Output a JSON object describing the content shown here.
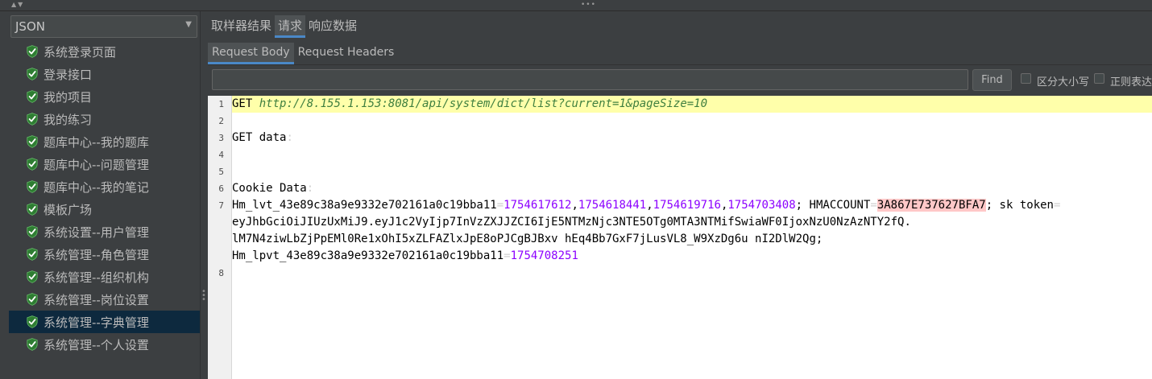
{
  "left_panel": {
    "combo": {
      "value": "JSON"
    },
    "tree": [
      {
        "label": "系统登录页面",
        "selected": false
      },
      {
        "label": "登录接口",
        "selected": false
      },
      {
        "label": "我的项目",
        "selected": false
      },
      {
        "label": "我的练习",
        "selected": false
      },
      {
        "label": "题库中心--我的题库",
        "selected": false
      },
      {
        "label": "题库中心--问题管理",
        "selected": false
      },
      {
        "label": "题库中心--我的笔记",
        "selected": false
      },
      {
        "label": "模板广场",
        "selected": false
      },
      {
        "label": "系统设置--用户管理",
        "selected": false
      },
      {
        "label": "系统管理--角色管理",
        "selected": false
      },
      {
        "label": "系统管理--组织机构",
        "selected": false
      },
      {
        "label": "系统管理--岗位设置",
        "selected": false
      },
      {
        "label": "系统管理--字典管理",
        "selected": true
      },
      {
        "label": "系统管理--个人设置",
        "selected": false
      }
    ],
    "status_icon": "green-shield-check-icon"
  },
  "result_tabs": [
    {
      "label": "取样器结果",
      "active": false
    },
    {
      "label": "请求",
      "active": true
    },
    {
      "label": "响应数据",
      "active": false
    }
  ],
  "request_tabs": [
    {
      "label": "Request Body",
      "active": true
    },
    {
      "label": "Request Headers",
      "active": false
    }
  ],
  "search": {
    "value": "",
    "find_label": "Find",
    "case_sensitive_label": "区分大小写",
    "regex_label": "正则表达"
  },
  "editor": {
    "line_numbers": [
      "1",
      "2",
      "3",
      "4",
      "5",
      "6",
      "7",
      "8"
    ],
    "line1": {
      "method": "GET",
      "url": "http://8.155.1.153:8081/api/system/dict/list?current=1&pageSize=10"
    },
    "line3": {
      "text": "GET data",
      "suffix": ":"
    },
    "line6": {
      "text": "Cookie Data",
      "suffix": ":"
    },
    "cookie": {
      "lvt_key": "Hm_lvt_43e89c38a9e9332e702161a0c19bba11",
      "lvt_values": [
        "1754617612",
        "1754618441",
        "1754619716",
        "1754703408"
      ],
      "hmaccount_key": "HMACCOUNT",
      "hmaccount_value": "3A867E737627BFA7",
      "sk_token_key": "sk token",
      "sk_token_part1": "eyJhbGciOiJIUzUxMiJ9.eyJ1c2VyIjp7InVzZXJJZCI6IjE5NTMzNjc3NTE5OTg0MTA3NTMifSwiaWF0IjoxNzU0NzAzNTY2fQ.",
      "sk_token_part2": "lM7N4ziwLbZjPpEMl0Re1xOhI5xZLFAZlxJpE8oPJCgBJBxv hEq4Bb7GxF7jLusVL8_W9XzDg6u nI2DlW2Qg;",
      "lpvt_key": "Hm_lpvt_43e89c38a9e9332e702161a0c19bba11",
      "lpvt_value": "1754708251"
    }
  },
  "colors": {
    "accent": "#4a88c7",
    "selected_row": "#0d293e",
    "shield_green": "#4caf50",
    "url_green": "#3f7f3f",
    "number_purple": "#8c00ff",
    "highlight_line": "#ffffaa"
  }
}
